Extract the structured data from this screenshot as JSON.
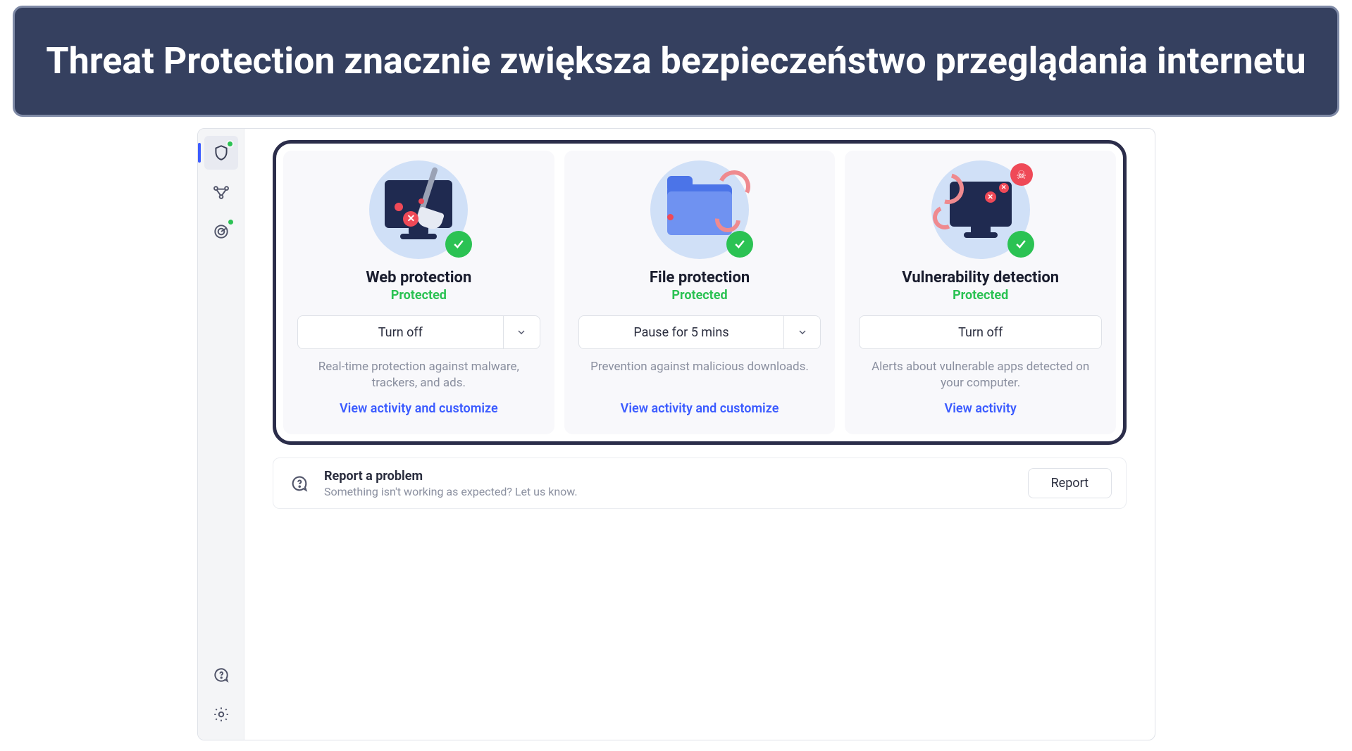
{
  "banner": {
    "text": "Threat Protection znacznie zwiększa bezpieczeństwo przeglądania internetu"
  },
  "cards": [
    {
      "title": "Web protection",
      "status": "Protected",
      "action": "Turn off",
      "has_chevron": true,
      "description": "Real-time protection against malware, trackers, and ads.",
      "link": "View activity and customize"
    },
    {
      "title": "File protection",
      "status": "Protected",
      "action": "Pause for 5 mins",
      "has_chevron": true,
      "description": "Prevention against malicious downloads.",
      "link": "View activity and customize"
    },
    {
      "title": "Vulnerability detection",
      "status": "Protected",
      "action": "Turn off",
      "has_chevron": false,
      "description": "Alerts about vulnerable apps detected on your computer.",
      "link": "View activity"
    }
  ],
  "report": {
    "title": "Report a problem",
    "subtitle": "Something isn't working as expected? Let us know.",
    "button": "Report"
  }
}
